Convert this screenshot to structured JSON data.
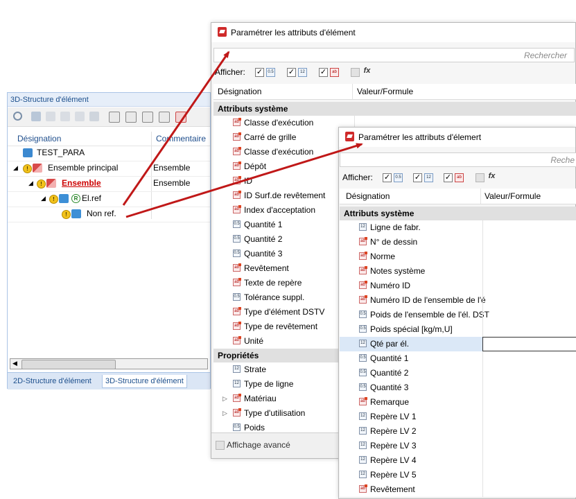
{
  "tree_panel": {
    "title": "3D-Structure d'élément",
    "col_designation": "Désignation",
    "col_comment": "Commentaire",
    "rows": [
      {
        "label": "TEST_PARA",
        "comment": ""
      },
      {
        "label": "Ensemble principal",
        "comment": "Ensemble"
      },
      {
        "label": "Ensemble",
        "comment": "Ensemble"
      },
      {
        "label": "El.ref",
        "comment": ""
      },
      {
        "label": "Non ref.",
        "comment": ""
      }
    ],
    "ref_badge": "R",
    "tabs": [
      "2D-Structure d'élément",
      "3D-Structure d'élément"
    ],
    "active_tab": "3D-Structure d'élément"
  },
  "dialog1": {
    "title": "Paramétrer les attributs d'élément",
    "search_placeholder": "Rechercher",
    "afficher_label": "Afficher:",
    "col_designation": "Désignation",
    "col_value": "Valeur/Formule",
    "section_system": "Attributs système",
    "system_items": [
      {
        "label": "Classe d'exécution",
        "icon": "ab"
      },
      {
        "label": "Carré de grille",
        "icon": "ab"
      },
      {
        "label": "Classe d'exécution",
        "icon": "ab"
      },
      {
        "label": "Dépôt",
        "icon": "ab"
      },
      {
        "label": "ID",
        "icon": "ab"
      },
      {
        "label": "ID Surf.de revêtement",
        "icon": "ab"
      },
      {
        "label": "Index d'acceptation",
        "icon": "ab"
      },
      {
        "label": "Quantité 1",
        "icon": "0.5"
      },
      {
        "label": "Quantité 2",
        "icon": "0.5"
      },
      {
        "label": "Quantité 3",
        "icon": "0.5"
      },
      {
        "label": "Revêtement",
        "icon": "ab"
      },
      {
        "label": "Texte de repère",
        "icon": "ab"
      },
      {
        "label": "Tolérance suppl.",
        "icon": "0.5"
      },
      {
        "label": "Type d'élément DSTV",
        "icon": "ab"
      },
      {
        "label": "Type de revêtement",
        "icon": "ab"
      },
      {
        "label": "Unité",
        "icon": "ab"
      }
    ],
    "section_props": "Propriétés",
    "prop_items": [
      {
        "label": "Strate",
        "icon": "12",
        "expand": false
      },
      {
        "label": "Type de ligne",
        "icon": "12",
        "expand": false
      },
      {
        "label": "Matériau",
        "icon": "ab",
        "expand": true
      },
      {
        "label": "Type d'utilisation",
        "icon": "ab",
        "expand": true
      },
      {
        "label": "Poids",
        "icon": "0.5",
        "expand": false
      }
    ],
    "advanced_label": "Affichage avancé"
  },
  "dialog2": {
    "title": "Paramétrer les attributs d'élemert",
    "search_placeholder": "Reche",
    "afficher_label": "Afficher:",
    "col_designation": "Désignation",
    "col_value": "Valeur/Formule",
    "section_system": "Attributs système",
    "items": [
      {
        "label": "Ligne de fabr.",
        "icon": "12"
      },
      {
        "label": "N° de dessin",
        "icon": "ab"
      },
      {
        "label": "Norme",
        "icon": "ab"
      },
      {
        "label": "Notes système",
        "icon": "ab"
      },
      {
        "label": "Numéro ID",
        "icon": "ab"
      },
      {
        "label": "Numéro ID de l'ensemble de l'é",
        "icon": "ab"
      },
      {
        "label": "Poids de l'ensemble de l'él. DST",
        "icon": "0.5"
      },
      {
        "label": "Poids spécial [kg/m,U]",
        "icon": "0.5"
      },
      {
        "label": "Qté par él.",
        "icon": "12",
        "selected": true
      },
      {
        "label": "Quantité 1",
        "icon": "0.5"
      },
      {
        "label": "Quantité 2",
        "icon": "0.5"
      },
      {
        "label": "Quantité 3",
        "icon": "0.5"
      },
      {
        "label": "Remarque",
        "icon": "ab"
      },
      {
        "label": "Repère LV 1",
        "icon": "12"
      },
      {
        "label": "Repère LV 2",
        "icon": "12"
      },
      {
        "label": "Repère LV 3",
        "icon": "12"
      },
      {
        "label": "Repère LV 4",
        "icon": "12"
      },
      {
        "label": "Repère LV 5",
        "icon": "12"
      },
      {
        "label": "Revêtement",
        "icon": "ab"
      }
    ]
  },
  "colors": {
    "arrow": "#c01818",
    "link_red": "#cc0000",
    "tree_header_blue": "#1f4e8c",
    "selection": "#dbe8f7"
  }
}
